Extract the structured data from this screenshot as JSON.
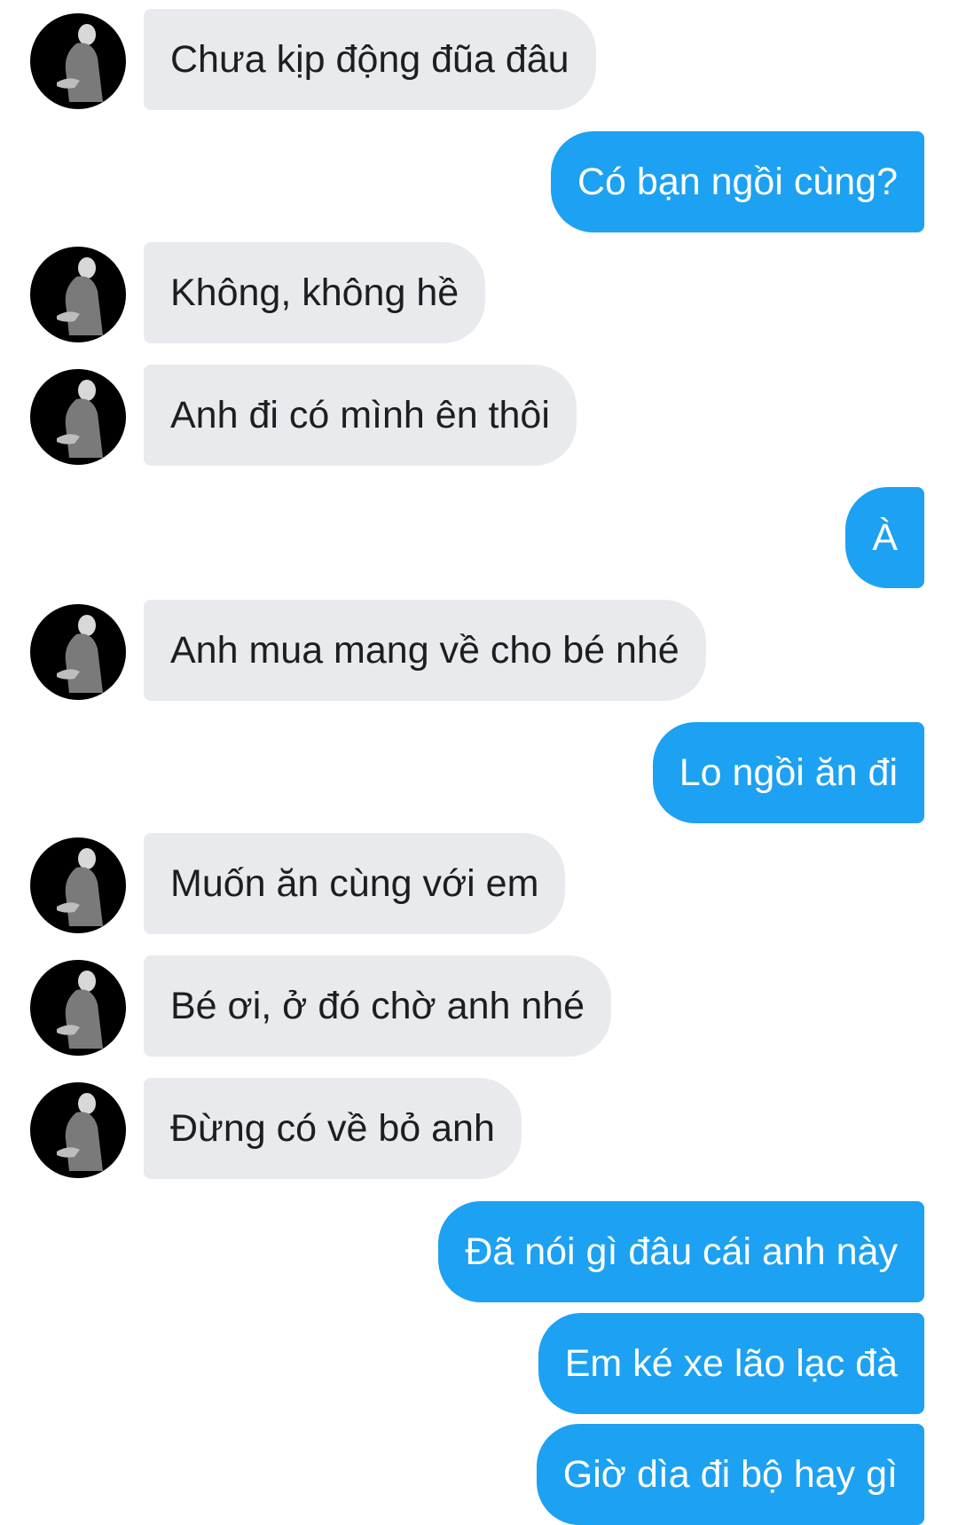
{
  "conversation": {
    "messages": [
      {
        "side": "in",
        "text": "Chưa kịp động đũa đâu"
      },
      {
        "side": "out",
        "text": "Có bạn ngồi cùng?"
      },
      {
        "side": "in",
        "text": "Không, không hề"
      },
      {
        "side": "in",
        "text": "Anh đi có mình ên thôi"
      },
      {
        "side": "out",
        "text": "À"
      },
      {
        "side": "in",
        "text": "Anh mua mang về cho bé nhé"
      },
      {
        "side": "out",
        "text": "Lo ngồi ăn đi"
      },
      {
        "side": "in",
        "text": "Muốn ăn cùng với em"
      },
      {
        "side": "in",
        "text": "Bé ơi, ở đó chờ anh nhé"
      },
      {
        "side": "in",
        "text": "Đừng có về bỏ anh"
      },
      {
        "side": "out",
        "text": "Đã nói gì đâu cái anh này"
      },
      {
        "side": "out",
        "text": "Em ké xe lão lạc đà"
      },
      {
        "side": "out",
        "text": "Giờ dìa đi bộ hay gì"
      }
    ]
  },
  "theme": {
    "incoming_bubble": "#e9eaee",
    "incoming_text": "#1c1e21",
    "outgoing_bubble": "#1da1f2",
    "outgoing_text": "#ffffff",
    "avatar_icon": "contact-avatar-photo"
  }
}
